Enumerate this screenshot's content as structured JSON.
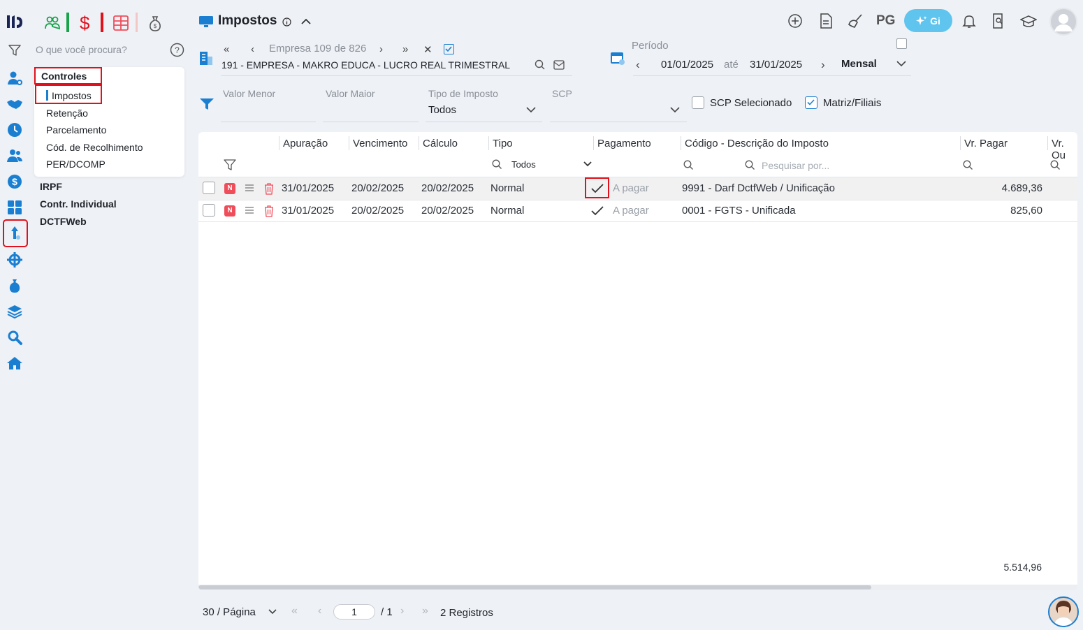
{
  "page": {
    "title": "Impostos",
    "info_icon": "info-icon"
  },
  "search": {
    "placeholder": "O que você procura?"
  },
  "menu": {
    "section": "Controles",
    "items": [
      "Impostos",
      "Retenção",
      "Parcelamento",
      "Cód. de Recolhimento",
      "PER/DCOMP"
    ],
    "others": [
      "IRPF",
      "Contr. Individual",
      "DCTFWeb"
    ]
  },
  "company_nav": {
    "label": "Empresa",
    "index": "109",
    "of_label": "de",
    "total": "826",
    "company_name": "191 - EMPRESA - MAKRO EDUCA - LUCRO REAL TRIMESTRAL"
  },
  "period": {
    "label": "Período",
    "start": "01/01/2025",
    "until_label": "até",
    "end": "31/01/2025",
    "mode": "Mensal"
  },
  "filters": {
    "valor_menor": "Valor Menor",
    "valor_maior": "Valor Maior",
    "tipo_imposto_label": "Tipo de Imposto",
    "tipo_imposto_value": "Todos",
    "scp_label": "SCP",
    "scp_selecionado": "SCP Selecionado",
    "matriz_filiais": "Matriz/Filiais"
  },
  "header_actions": {
    "pg": "PG",
    "gi": "Gi"
  },
  "table": {
    "columns": [
      "Apuração",
      "Vencimento",
      "Cálculo",
      "Tipo",
      "Pagamento",
      "Código - Descrição do Imposto",
      "Vr. Pagar",
      "Vr. Ou"
    ],
    "tipo_filter": "Todos",
    "search_placeholder": "Pesquisar por...",
    "rows": [
      {
        "badge": "N",
        "apuracao": "31/01/2025",
        "vencimento": "20/02/2025",
        "calculo": "20/02/2025",
        "tipo": "Normal",
        "pagamento": "A pagar",
        "descricao": "9991 - Darf DctfWeb / Unificação",
        "vr_pagar": "4.689,36"
      },
      {
        "badge": "N",
        "apuracao": "31/01/2025",
        "vencimento": "20/02/2025",
        "calculo": "20/02/2025",
        "tipo": "Normal",
        "pagamento": "A pagar",
        "descricao": "0001 - FGTS - Unificada",
        "vr_pagar": "825,60"
      }
    ],
    "total": "5.514,96"
  },
  "pagination": {
    "per_page": "30 / Página",
    "page": "1",
    "pages": "/ 1",
    "records": "2 Registros"
  },
  "colors": {
    "accent_blue": "#1b7fd1",
    "highlight_red": "#e0111c",
    "badge_red": "#ef4d5a",
    "gi_pill": "#5fc4ee"
  }
}
